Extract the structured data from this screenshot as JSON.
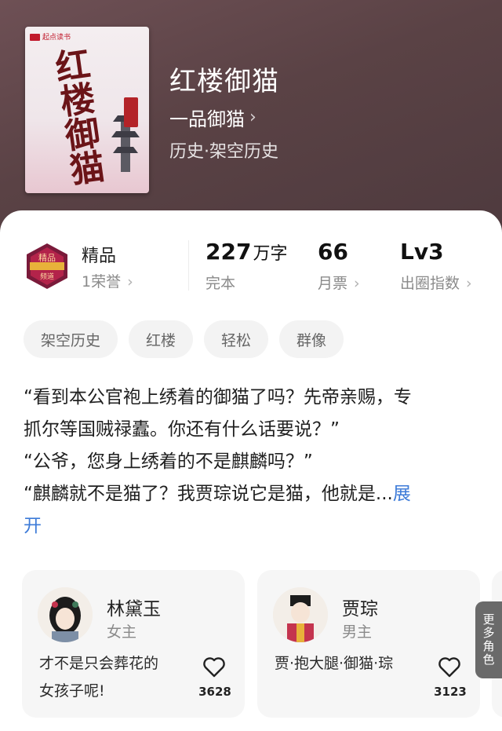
{
  "book": {
    "cover_brand": "起点读书",
    "cover_title": "红楼御猫",
    "title": "红楼御猫",
    "author": "一品御猫",
    "genre": "历史·架空历史"
  },
  "stats": {
    "honor": {
      "title": "精品",
      "sub": "1荣誉"
    },
    "words": {
      "value": "227",
      "unit": "万字",
      "label": "完本"
    },
    "monthly": {
      "value": "66",
      "label": "月票"
    },
    "circle": {
      "value": "Lv3",
      "label": "出圈指数"
    }
  },
  "tags": [
    "架空历史",
    "红楼",
    "轻松",
    "群像"
  ],
  "synopsis": {
    "lines": [
      "“看到本公官袍上绣着的御猫了吗？先帝亲赐，专",
      "抓尔等国贼禄蠹。你还有什么话要说？”",
      "“公爷，您身上绣着的不是麒麟吗？”",
      "“麒麟就不是猫了？我贾琮说它是猫，他就是..."
    ],
    "expand_part1": "展",
    "expand_part2": "开"
  },
  "roles": [
    {
      "name": "林黛玉",
      "type": "女主",
      "quote_line1": "才不是只会葬花的",
      "quote_line2": "女孩子呢!",
      "likes": "3628"
    },
    {
      "name": "贾琮",
      "type": "男主",
      "quote_line1": "",
      "quote_line2": "贾·抱大腿·御猫·琮",
      "likes": "3123"
    }
  ],
  "more_roles_label": "更多角色",
  "colors": {
    "accent_link": "#3d7bd8",
    "header_bg": "#5a4245",
    "badge": "#7a1a3a"
  }
}
